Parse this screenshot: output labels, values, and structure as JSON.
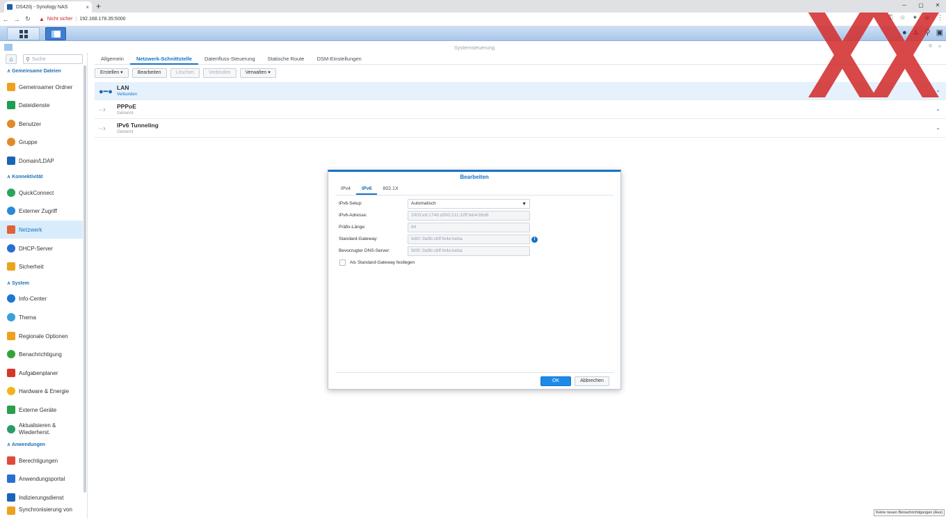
{
  "browser": {
    "tab_title": "DS420j - Synology NAS",
    "new_tab": "+",
    "close": "×",
    "not_secure": "Nicht sicher",
    "url": "192.168.178.35:5000",
    "win_minimize": "─",
    "win_maximize": "▢",
    "win_close": "✕"
  },
  "window": {
    "title": "Systemsteuerung"
  },
  "sidebar": {
    "search_placeholder": "Suche",
    "sections": [
      {
        "label": "Gemeinsame Dateien"
      },
      {
        "label": "Konnektivität"
      },
      {
        "label": "System"
      },
      {
        "label": "Anwendungen"
      }
    ],
    "items": [
      {
        "label": "Gemeinsamer Ordner",
        "color": "#f0a020"
      },
      {
        "label": "Dateidienste",
        "color": "#1e9e52"
      },
      {
        "label": "Benutzer",
        "color": "#e08a2a"
      },
      {
        "label": "Gruppe",
        "color": "#e08a2a"
      },
      {
        "label": "Domain/LDAP",
        "color": "#1a64b8"
      },
      {
        "label": "QuickConnect",
        "color": "#2aa55a"
      },
      {
        "label": "Externer Zugriff",
        "color": "#2a8ad8"
      },
      {
        "label": "Netzwerk",
        "color": "#e0623a"
      },
      {
        "label": "DHCP-Server",
        "color": "#2a6fd0"
      },
      {
        "label": "Sicherheit",
        "color": "#e8a51c"
      },
      {
        "label": "Info-Center",
        "color": "#1a78d0"
      },
      {
        "label": "Thema",
        "color": "#3aa0d8"
      },
      {
        "label": "Regionale Optionen",
        "color": "#f0a020"
      },
      {
        "label": "Benachrichtigung",
        "color": "#35a33a"
      },
      {
        "label": "Aufgabenplaner",
        "color": "#d8342a"
      },
      {
        "label": "Hardware & Energie",
        "color": "#f2b31a"
      },
      {
        "label": "Externe Geräte",
        "color": "#2aa04a"
      },
      {
        "label": "Aktualisieren &",
        "label2": "Wiederherst.",
        "color": "#2a9a6a"
      },
      {
        "label": "Berechtigungen",
        "color": "#e04a3a"
      },
      {
        "label": "Anwendungsportal",
        "color": "#2a6fd0"
      },
      {
        "label": "Indizierungsdienst",
        "color": "#1a64b8"
      },
      {
        "label": "Synchronisierung von",
        "color": "#f0a020"
      }
    ]
  },
  "main": {
    "tabs": [
      "Allgemein",
      "Netzwerk-Schnittstelle",
      "Datenfluss-Steuerung",
      "Statische Route",
      "DSM-Einstellungen"
    ],
    "toolbar": {
      "create": "Erstellen ▾",
      "edit": "Bearbeiten",
      "delete": "Löschen",
      "connect": "Verbinden",
      "manage": "Verwalten ▾"
    },
    "interfaces": [
      {
        "name": "LAN",
        "status": "Verbunden"
      },
      {
        "name": "PPPoE",
        "status": "Getrennt"
      },
      {
        "name": "IPv6 Tunneling",
        "status": "Getrennt"
      }
    ]
  },
  "dialog": {
    "title": "Bearbeiten",
    "tabs": [
      "IPv4",
      "IPv6",
      "802.1X"
    ],
    "fields": [
      {
        "label": "IPv6-Setup:",
        "value": "Automatisch"
      },
      {
        "label": "IPv6-Adresse:",
        "value": "2003:e9:1746:d300:211:32ff:feb4:86d6"
      },
      {
        "label": "Präfix-Länge:",
        "value": "64"
      },
      {
        "label": "Standard-Gateway:",
        "value": "fe80::9a9b:cbff:fe4e:beba"
      },
      {
        "label": "Bevorzugter DNS-Server:",
        "value": "fd00::9a9b:cbff:fe4e:beba"
      }
    ],
    "checkbox_label": "Als Standard-Gateway festlegen",
    "ok": "OK",
    "cancel": "Abbrechen"
  },
  "notification": "Keine neuen Benachrichtigungen (Aus)"
}
